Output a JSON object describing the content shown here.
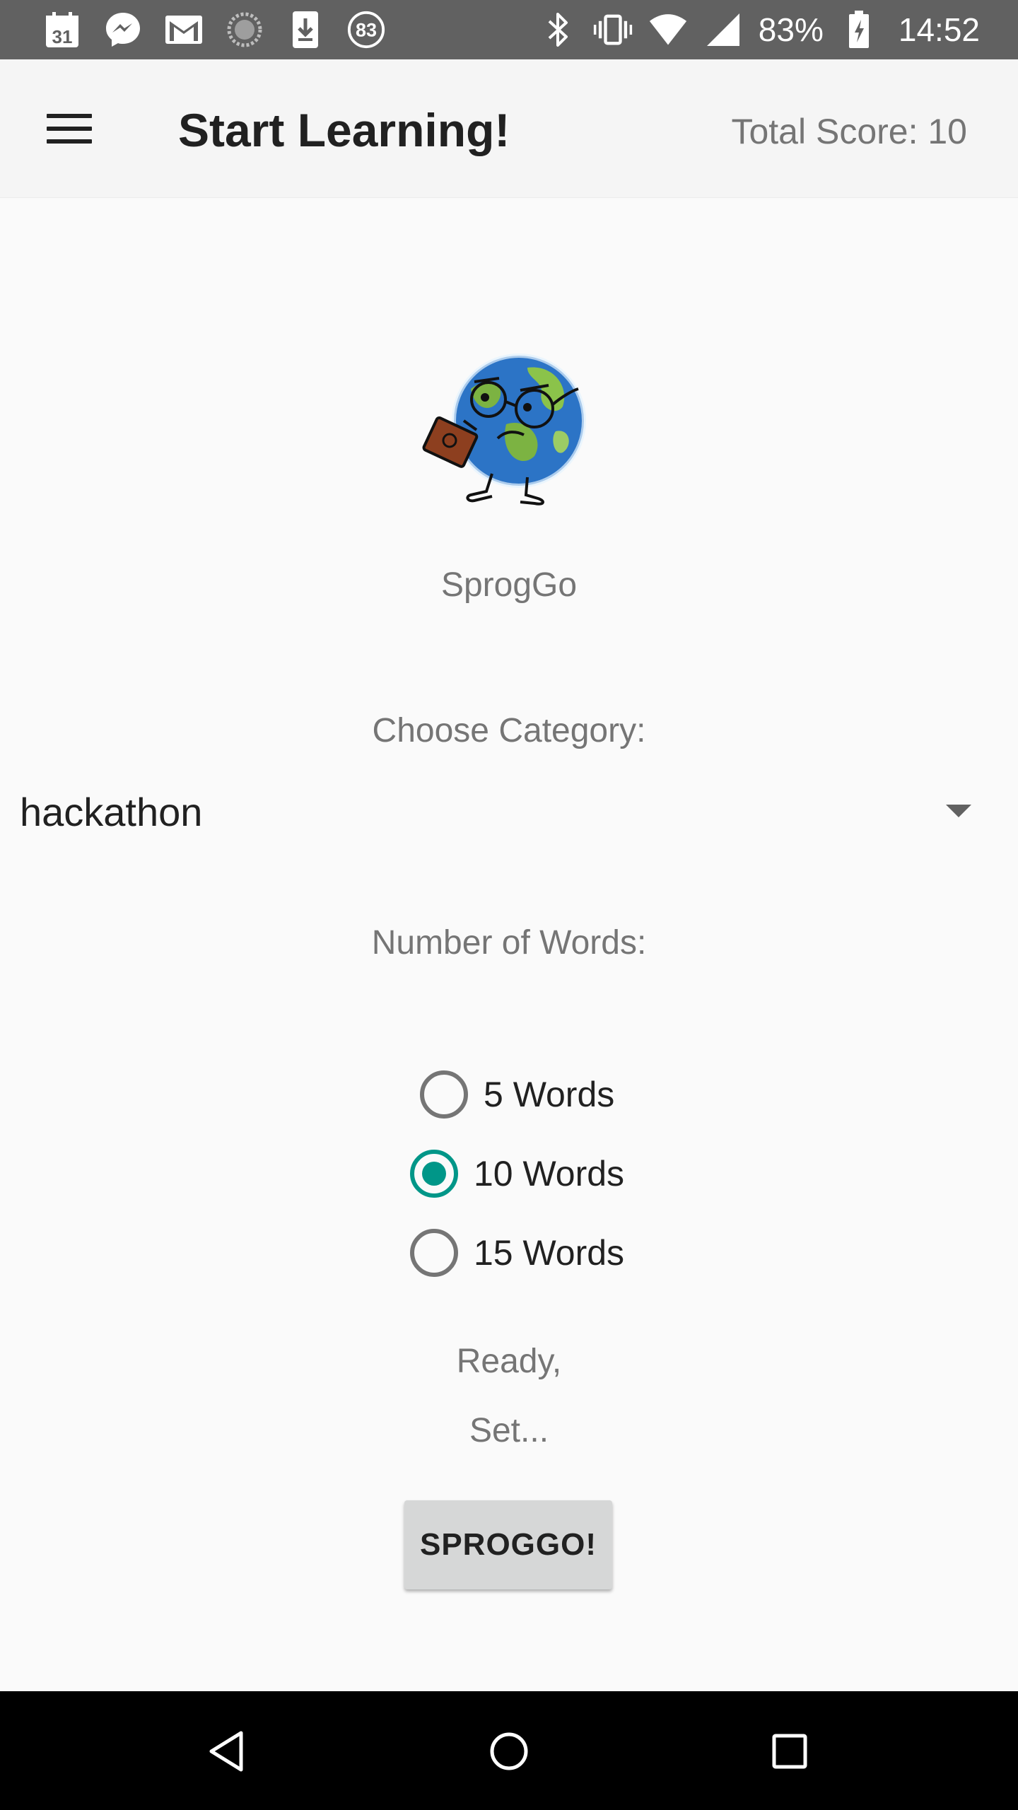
{
  "status_bar": {
    "calendar_day": "31",
    "badge_count": "83",
    "battery": "83%",
    "time": "14:52",
    "icons": [
      "calendar-icon",
      "messenger-icon",
      "gmail-icon",
      "sync-icon",
      "download-icon",
      "badge-icon",
      "bluetooth-icon",
      "vibrate-icon",
      "wifi-icon",
      "signal-icon",
      "battery-charging-icon"
    ]
  },
  "app_bar": {
    "menu_icon": "hamburger-menu-icon",
    "title": "Start Learning!",
    "total_score": "Total Score: 10"
  },
  "main": {
    "logo_icon": "globe-mascot-icon",
    "app_name": "SprogGo",
    "category_label": "Choose Category:",
    "category_value": "hackathon",
    "words_label": "Number of Words:",
    "word_options": [
      {
        "label": "5 Words",
        "checked": false
      },
      {
        "label": "10 Words",
        "checked": true
      },
      {
        "label": "15 Words",
        "checked": false
      }
    ],
    "ready_text": "Ready,",
    "set_text": "Set...",
    "go_button": "SPROGGO!"
  },
  "colors": {
    "accent": "#009688",
    "status_bar": "#616161",
    "app_bar": "#f5f5f5",
    "background": "#fafafa",
    "button": "#d6d7d7"
  },
  "nav_bar": {
    "icons": [
      "back-icon",
      "home-icon",
      "recents-icon"
    ]
  }
}
